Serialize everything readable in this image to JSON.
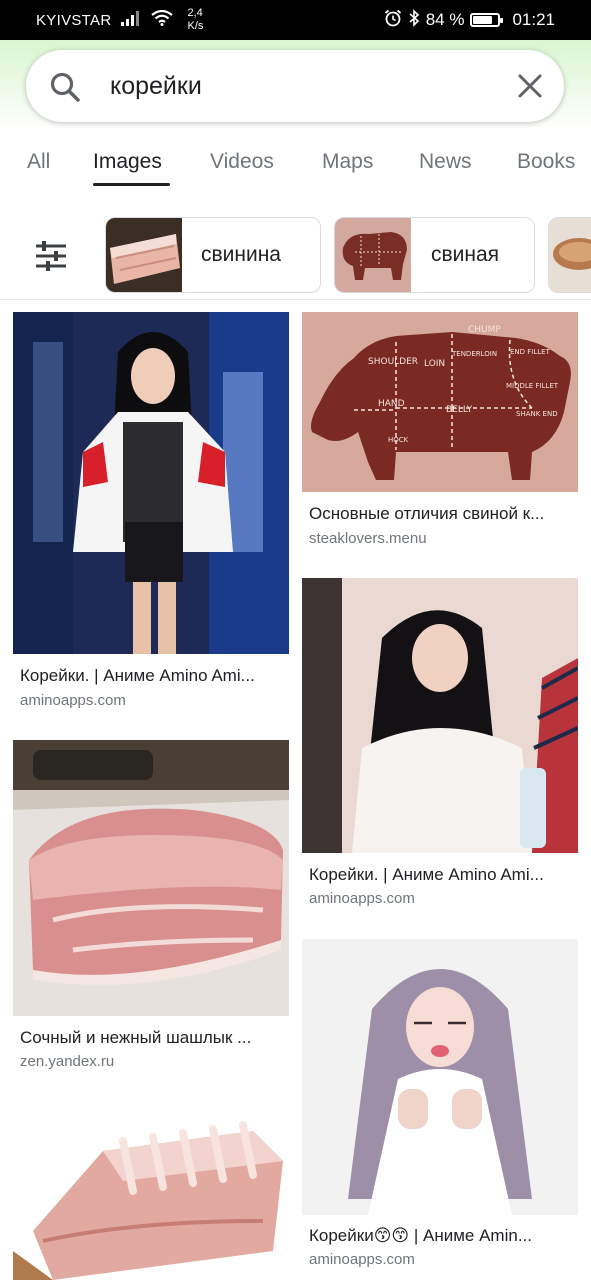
{
  "status_bar": {
    "carrier": "KYIVSTAR",
    "speed_value": "2,4",
    "speed_unit": "K/s",
    "battery": "84 %",
    "battery_level": 0.84,
    "time": "01:21"
  },
  "search": {
    "query": "корейки"
  },
  "tabs": [
    {
      "label": "All"
    },
    {
      "label": "Images"
    },
    {
      "label": "Videos"
    },
    {
      "label": "Maps"
    },
    {
      "label": "News"
    },
    {
      "label": "Books"
    }
  ],
  "active_tab": "Images",
  "chips": [
    {
      "label": "свинина"
    },
    {
      "label": "свиная"
    }
  ],
  "results": [
    {
      "title": "Корейки. | Аниме Amino Ami...",
      "source": "aminoapps.com"
    },
    {
      "title": "Основные отличия свиной к...",
      "source": "steaklovers.menu"
    },
    {
      "title": "Сочный и нежный шашлык ...",
      "source": "zen.yandex.ru"
    },
    {
      "title": "Корейки. | Аниме Amino Ami...",
      "source": "aminoapps.com"
    },
    {
      "title": "Корейки😙😙 | Аниме Amin...",
      "source": "aminoapps.com"
    }
  ],
  "pig_diagram": {
    "labels": [
      "SHOULDER",
      "LOIN",
      "CHUMP",
      "TENDERLOIN",
      "END FILLET",
      "MIDDLE FILLET",
      "HAND",
      "BELLY",
      "SHANK END",
      "HOCK"
    ]
  },
  "colors": {
    "accent_tab": "#202124",
    "source_text": "#70757a",
    "header_gradient_top": "#d9f5cf"
  }
}
